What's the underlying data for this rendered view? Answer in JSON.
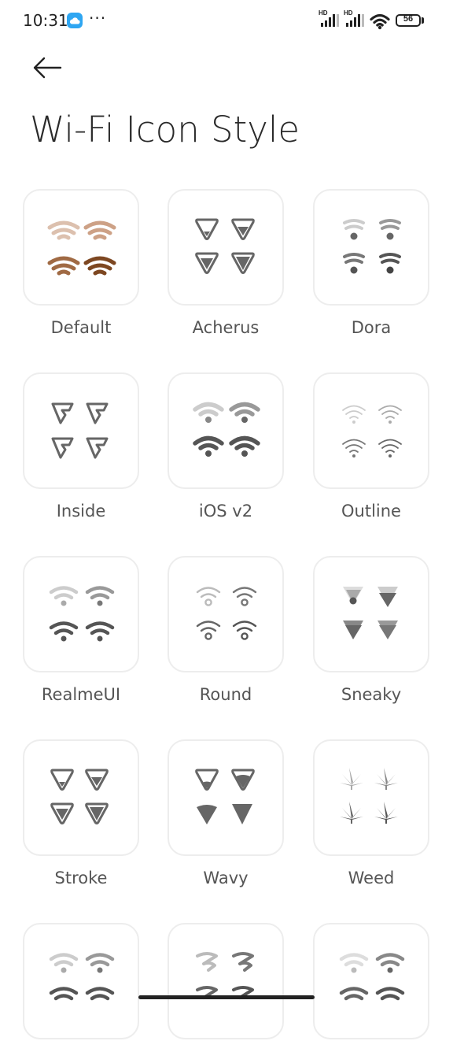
{
  "status_bar": {
    "time": "10:31",
    "overflow": "···",
    "battery_level": "56",
    "hd_label": "HD",
    "icons": [
      "cloud-icon",
      "signal-icon",
      "wifi-icon",
      "battery-icon"
    ]
  },
  "header": {
    "back_icon": "back-arrow-icon",
    "title": "Wi-Fi Icon Style"
  },
  "styles": [
    {
      "label": "Default",
      "icon": "wifi-arcs-icon",
      "colors": [
        "#d8b8a4",
        "#c8987c",
        "#9a6238",
        "#7a4420"
      ]
    },
    {
      "label": "Acherus",
      "icon": "wifi-shield-icon"
    },
    {
      "label": "Dora",
      "icon": "wifi-stacked-icon"
    },
    {
      "label": "Inside",
      "icon": "wifi-folded-icon"
    },
    {
      "label": "iOS v2",
      "icon": "wifi-arcs-icon"
    },
    {
      "label": "Outline",
      "icon": "wifi-outline-icon"
    },
    {
      "label": "RealmeUI",
      "icon": "wifi-arcs-icon"
    },
    {
      "label": "Round",
      "icon": "wifi-round-icon"
    },
    {
      "label": "Sneaky",
      "icon": "wifi-sneaky-icon"
    },
    {
      "label": "Stroke",
      "icon": "wifi-shield-icon"
    },
    {
      "label": "Wavy",
      "icon": "wifi-wavy-icon"
    },
    {
      "label": "Weed",
      "icon": "leaf-icon"
    },
    {
      "label": "",
      "icon": "wifi-arcs-icon"
    },
    {
      "label": "",
      "icon": "wifi-wavy-icon"
    },
    {
      "label": "",
      "icon": "wifi-arcs-icon"
    }
  ]
}
